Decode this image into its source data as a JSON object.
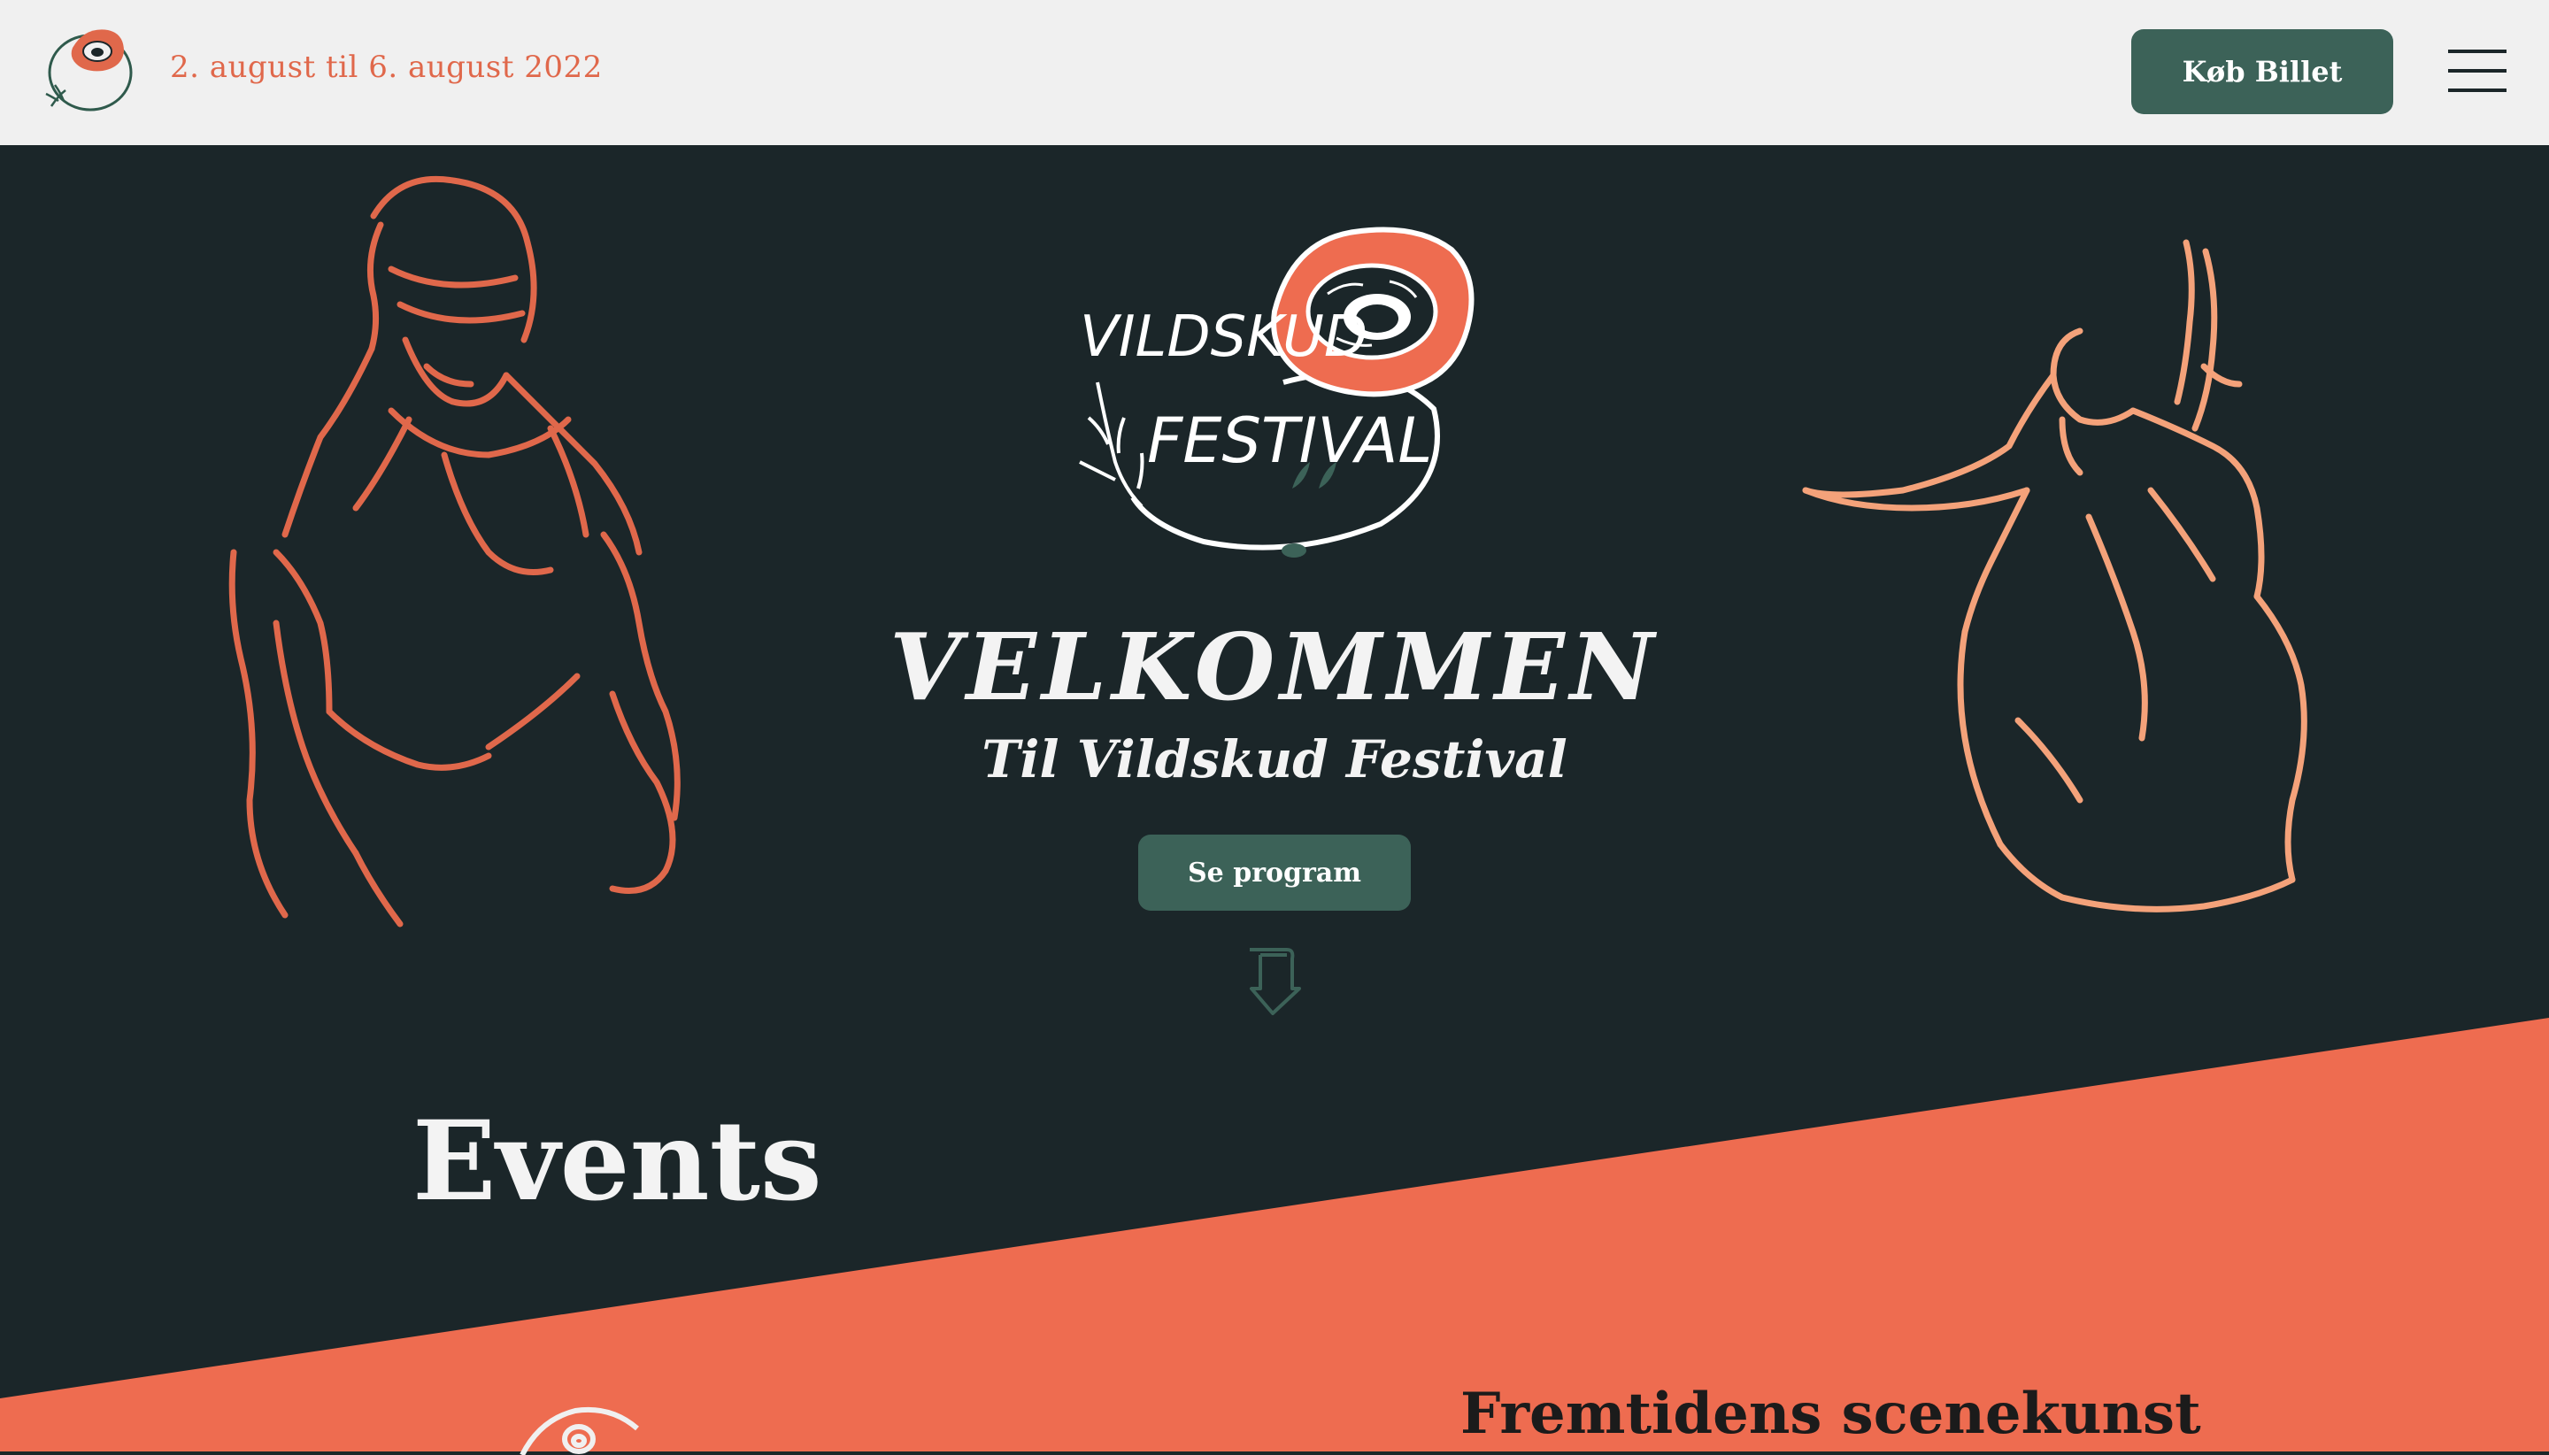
{
  "header": {
    "dates": "2. august til 6. august 2022",
    "buy_button": "Køb Billet",
    "logo_icon": "festival-logo-icon",
    "menu_icon": "hamburger-menu-icon"
  },
  "hero": {
    "logo_lines": [
      "VILDSKUD",
      "FESTIVAL"
    ],
    "title": "VELKOMMEN",
    "subtitle": "Til Vildskud Festival",
    "program_button": "Se program",
    "scroll_icon": "arrow-down-icon"
  },
  "events": {
    "heading": "Events",
    "section_heading": "Fremtidens scenekunst"
  },
  "colors": {
    "header_bg": "#f0f0f0",
    "dark_bg": "#1b2629",
    "accent_orange": "#ee6c50",
    "button_green": "#3c6258",
    "figure_orange": "#e0684b",
    "figure_peach": "#f4a27a",
    "text_light": "#f3f3f3"
  }
}
